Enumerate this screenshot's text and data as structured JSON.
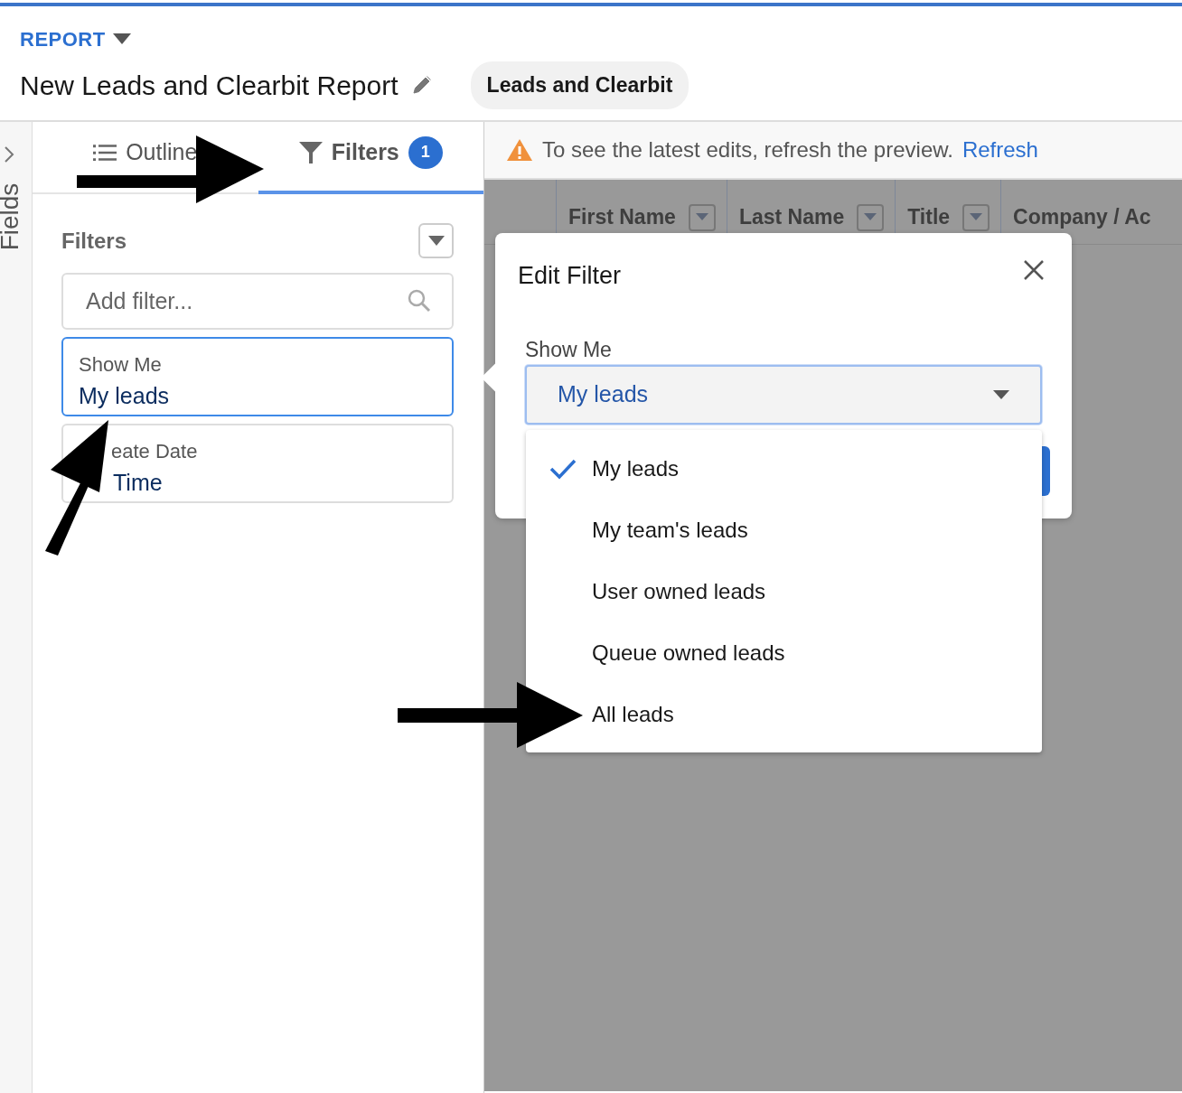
{
  "header": {
    "label": "REPORT",
    "title": "New Leads and Clearbit Report",
    "report_type": "Leads and Clearbit"
  },
  "fields_rail": {
    "label": "Fields"
  },
  "tabs": [
    {
      "label": "Outline",
      "selected": false
    },
    {
      "label": "Filters",
      "selected": true,
      "count": "1"
    }
  ],
  "filters_panel": {
    "heading": "Filters",
    "search": {
      "placeholder": "Add filter..."
    },
    "filters": [
      {
        "label": "Show Me",
        "value": "My leads",
        "selected": true
      },
      {
        "label": "eate Date",
        "value": "Time",
        "selected": false
      }
    ]
  },
  "notice": {
    "text": "To see the latest edits, refresh the preview.",
    "link": "Refresh"
  },
  "table": {
    "columns": [
      "First Name",
      "Last Name",
      "Title",
      "Company / Ac"
    ]
  },
  "modal": {
    "title": "Edit Filter",
    "field_label": "Show Me",
    "value": "My leads",
    "options": [
      {
        "label": "My leads",
        "selected": true
      },
      {
        "label": "My team's leads",
        "selected": false
      },
      {
        "label": "User owned leads",
        "selected": false
      },
      {
        "label": "Queue owned leads",
        "selected": false
      },
      {
        "label": "All leads",
        "selected": false
      }
    ]
  }
}
